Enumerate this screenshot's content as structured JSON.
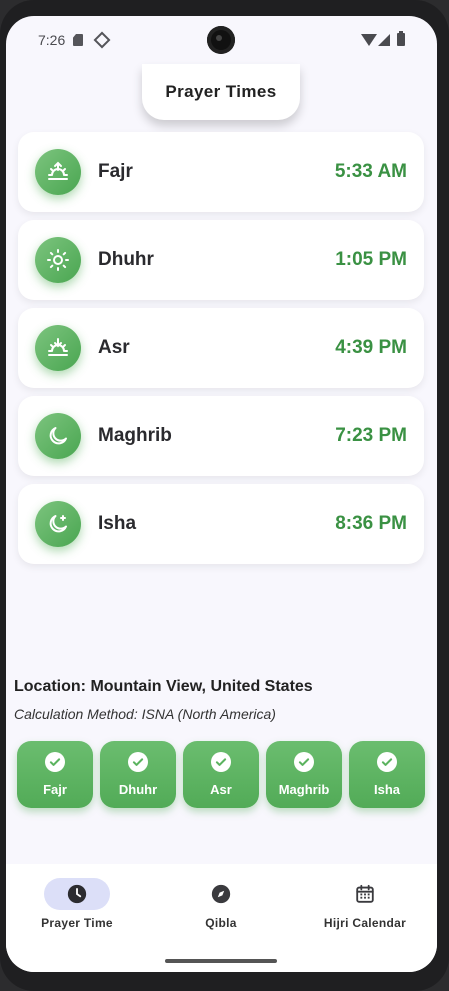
{
  "status_bar": {
    "time": "7:26",
    "icons": [
      "sim-card-icon",
      "diamond-icon",
      "wifi-icon",
      "signal-icon",
      "battery-icon"
    ]
  },
  "header": {
    "title": "Prayer Times"
  },
  "prayers": [
    {
      "name": "Fajr",
      "time": "5:33 AM",
      "icon": "sunrise-icon"
    },
    {
      "name": "Dhuhr",
      "time": "1:05 PM",
      "icon": "sun-icon"
    },
    {
      "name": "Asr",
      "time": "4:39 PM",
      "icon": "sunset-icon"
    },
    {
      "name": "Maghrib",
      "time": "7:23 PM",
      "icon": "moon-icon"
    },
    {
      "name": "Isha",
      "time": "8:36 PM",
      "icon": "moon-stars-icon"
    }
  ],
  "info": {
    "location": "Location: Mountain View, United States",
    "method": "Calculation Method: ISNA (North America)"
  },
  "tracker": [
    {
      "label": "Fajr",
      "done": true
    },
    {
      "label": "Dhuhr",
      "done": true
    },
    {
      "label": "Asr",
      "done": true
    },
    {
      "label": "Maghrib",
      "done": true
    },
    {
      "label": "Isha",
      "done": true
    }
  ],
  "nav": [
    {
      "label": "Prayer Time",
      "icon": "clock-icon",
      "active": true
    },
    {
      "label": "Qibla",
      "icon": "compass-icon",
      "active": false
    },
    {
      "label": "Hijri Calendar",
      "icon": "calendar-icon",
      "active": false
    }
  ],
  "colors": {
    "accent": "#4aa651",
    "time_text": "#3a9143",
    "nav_active": "#dcdff8",
    "background": "#f8f7fd"
  }
}
